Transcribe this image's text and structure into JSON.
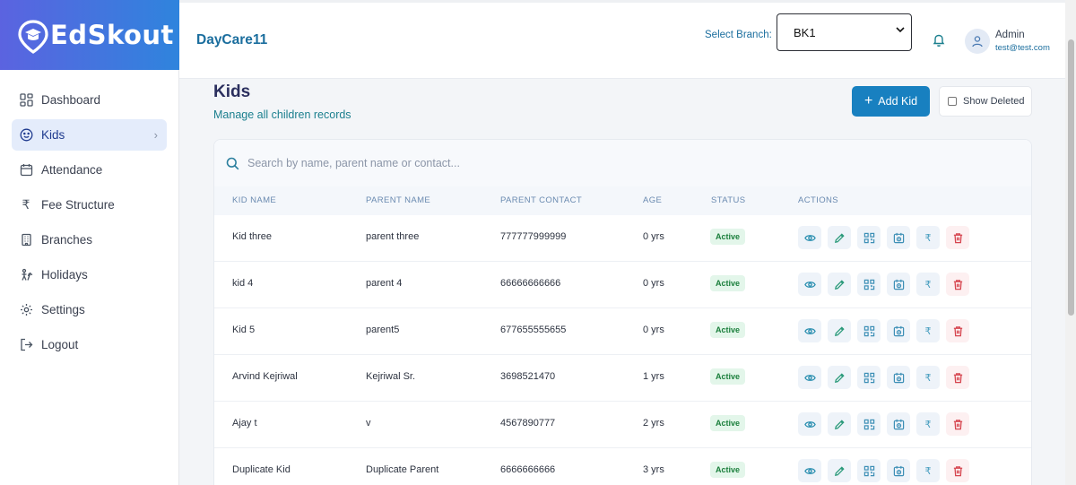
{
  "app": {
    "logo_text": "EdSkout",
    "brand": "DayCare11"
  },
  "colors": {
    "primary": "#1880c0",
    "teal": "#1b7f8e",
    "active_badge_bg": "#e3f6ea",
    "active_badge_fg": "#1b7f3c"
  },
  "sidebar": {
    "items": [
      {
        "label": "Dashboard",
        "icon": "grid-icon"
      },
      {
        "label": "Kids",
        "icon": "smile-icon",
        "active": true
      },
      {
        "label": "Attendance",
        "icon": "calendar-icon"
      },
      {
        "label": "Fee Structure",
        "icon": "rupee-icon"
      },
      {
        "label": "Branches",
        "icon": "building-icon"
      },
      {
        "label": "Holidays",
        "icon": "holiday-icon"
      },
      {
        "label": "Settings",
        "icon": "gear-icon"
      },
      {
        "label": "Logout",
        "icon": "logout-icon"
      }
    ]
  },
  "header": {
    "branch_label": "Select Branch:",
    "branch_value": "BK1",
    "user_name": "Admin",
    "user_email": "test@test.com"
  },
  "page": {
    "title": "Kids",
    "subtitle": "Manage all children records",
    "add_button": "Add Kid",
    "show_deleted": "Show Deleted"
  },
  "search": {
    "placeholder": "Search by name, parent name or contact..."
  },
  "table": {
    "columns": [
      "KID NAME",
      "PARENT NAME",
      "PARENT CONTACT",
      "AGE",
      "STATUS",
      "ACTIONS"
    ],
    "rows": [
      {
        "kid": "Kid three",
        "parent": "parent three",
        "contact": "777777999999",
        "age": "0 yrs",
        "status": "Active"
      },
      {
        "kid": "kid 4",
        "parent": "parent 4",
        "contact": "66666666666",
        "age": "0 yrs",
        "status": "Active"
      },
      {
        "kid": "Kid 5",
        "parent": "parent5",
        "contact": "677655555655",
        "age": "0 yrs",
        "status": "Active"
      },
      {
        "kid": "Arvind Kejriwal",
        "parent": "Kejriwal Sr.",
        "contact": "3698521470",
        "age": "1 yrs",
        "status": "Active"
      },
      {
        "kid": "Ajay t",
        "parent": "v",
        "contact": "4567890777",
        "age": "2 yrs",
        "status": "Active"
      },
      {
        "kid": "Duplicate Kid",
        "parent": "Duplicate Parent",
        "contact": "6666666666",
        "age": "3 yrs",
        "status": "Active"
      }
    ],
    "actions": [
      "view-icon",
      "edit-icon",
      "qr-code-icon",
      "schedule-icon",
      "rupee-icon",
      "delete-icon"
    ],
    "fee_symbol": "₹"
  }
}
